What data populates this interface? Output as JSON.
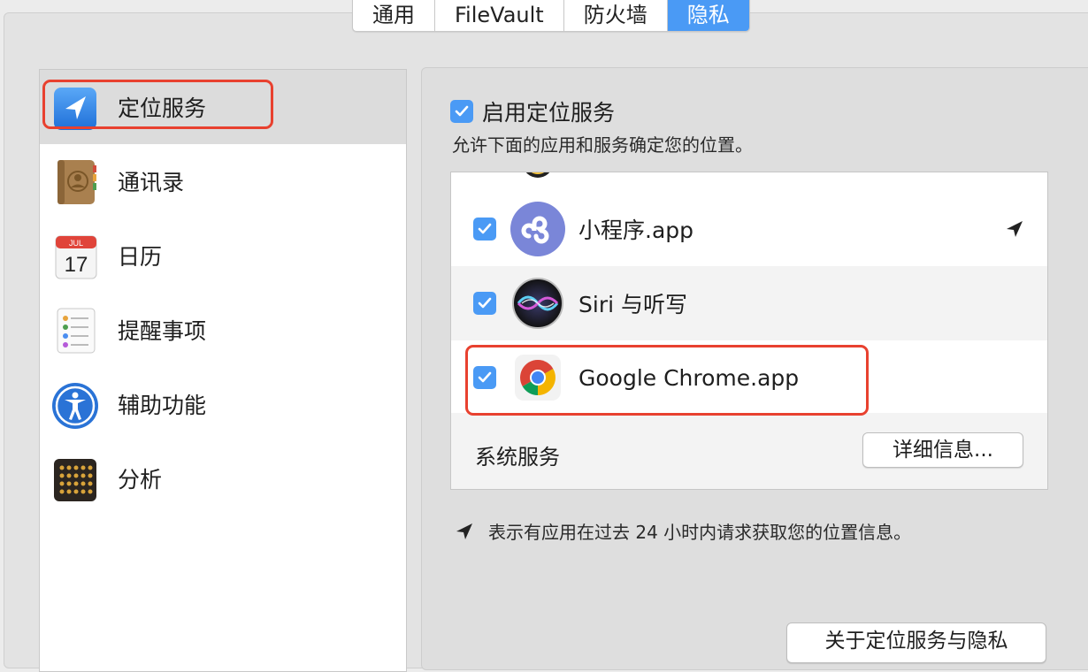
{
  "tabs": [
    {
      "label": "通用",
      "active": false
    },
    {
      "label": "FileVault",
      "active": false
    },
    {
      "label": "防火墙",
      "active": false
    },
    {
      "label": "隐私",
      "active": true
    }
  ],
  "sidebar": {
    "items": [
      {
        "label": "定位服务",
        "icon": "location-icon",
        "selected": true
      },
      {
        "label": "通讯录",
        "icon": "contacts-icon"
      },
      {
        "label": "日历",
        "icon": "calendar-icon",
        "icon_month": "JUL",
        "icon_day": "17"
      },
      {
        "label": "提醒事项",
        "icon": "reminders-icon"
      },
      {
        "label": "辅助功能",
        "icon": "accessibility-icon"
      },
      {
        "label": "分析",
        "icon": "analytics-icon"
      }
    ]
  },
  "main": {
    "enable_label": "启用定位服务",
    "enable_checked": true,
    "description": "允许下面的应用和服务确定您的位置。",
    "apps": [
      {
        "name": "小程序.app",
        "checked": true,
        "icon": "mini-program-icon",
        "recent_location": true
      },
      {
        "name": "Siri 与听写",
        "checked": true,
        "icon": "siri-icon",
        "recent_location": false
      },
      {
        "name": "Google Chrome.app",
        "checked": true,
        "icon": "chrome-icon",
        "recent_location": false
      }
    ],
    "system_services_label": "系统服务",
    "details_button": "详细信息...",
    "note": "表示有应用在过去 24 小时内请求获取您的位置信息。",
    "about_button": "关于定位服务与隐私"
  },
  "colors": {
    "accent": "#4a9af5",
    "highlight": "#e8412f",
    "selected_row": "#dcdcdc"
  }
}
